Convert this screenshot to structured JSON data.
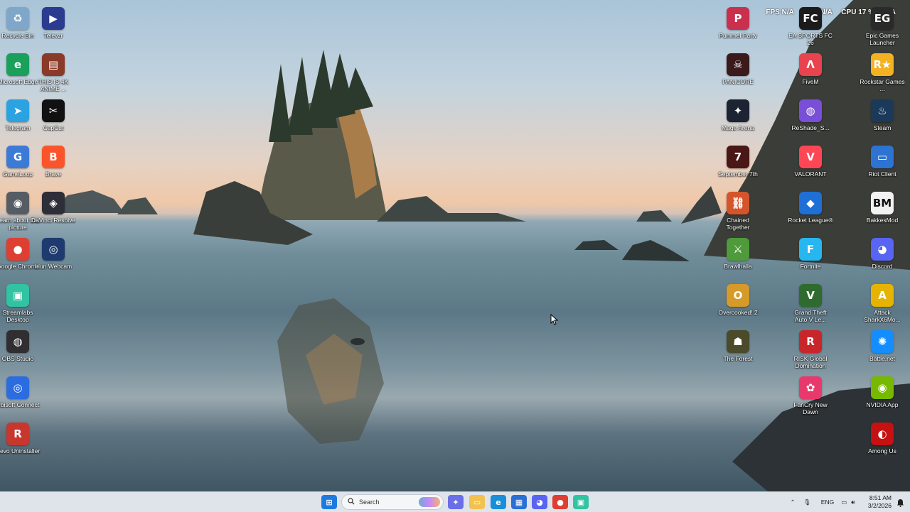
{
  "desktop": {
    "icons": [
      {
        "label": "Recycle Bin",
        "icon": "recycle-bin-icon",
        "glyph": "♻",
        "color": "#7fa7c9"
      },
      {
        "label": "Microsoft Edge",
        "icon": "edge-icon",
        "glyph": "e",
        "color": "#1aa05b"
      },
      {
        "label": "Telegram",
        "icon": "telegram-icon",
        "glyph": "➤",
        "color": "#2aa3e0"
      },
      {
        "label": "GameLoop",
        "icon": "gameloop-icon",
        "glyph": "G",
        "color": "#3b7bd6"
      },
      {
        "label": "Learn about this picture",
        "icon": "camera-icon",
        "glyph": "◉",
        "color": "#555c64"
      },
      {
        "label": "Google Chrome",
        "icon": "chrome-icon",
        "glyph": "●",
        "color": "#de3f33"
      },
      {
        "label": "Streamlabs Desktop",
        "icon": "streamlabs-icon",
        "glyph": "▣",
        "color": "#31c3a2"
      },
      {
        "label": "OBS Studio",
        "icon": "obs-icon",
        "glyph": "◍",
        "color": "#302e31"
      },
      {
        "label": "Ubisoft Connect",
        "icon": "ubisoft-icon",
        "glyph": "◎",
        "color": "#2b6de0"
      },
      {
        "label": "Revo Uninstaller",
        "icon": "revo-uninstaller-icon",
        "glyph": "R",
        "color": "#c8372d"
      },
      {
        "label": "Televzr",
        "icon": "televzr-icon",
        "glyph": "▶",
        "color": "#2b3b8f"
      },
      {
        "label": "THIS IS 4K ANIME ...",
        "icon": "video-file-icon",
        "glyph": "▤",
        "color": "#8a3a28"
      },
      {
        "label": "CapCut",
        "icon": "capcut-icon",
        "glyph": "✂",
        "color": "#111111"
      },
      {
        "label": "Brave",
        "icon": "brave-icon",
        "glyph": "B",
        "color": "#fb542b"
      },
      {
        "label": "DaVinci Resolve",
        "icon": "davinci-resolve-icon",
        "glyph": "◈",
        "color": "#2c2f38"
      },
      {
        "label": "Iriun Webcam",
        "icon": "webcam-icon",
        "glyph": "◎",
        "color": "#1e3a6e"
      },
      {
        "label": "Pummel Party",
        "icon": "pummel-party-icon",
        "glyph": "P",
        "color": "#c9304d"
      },
      {
        "label": "PANICORE",
        "icon": "panicore-icon",
        "glyph": "☠",
        "color": "#3a1a1a"
      },
      {
        "label": "Mage Arena",
        "icon": "mage-arena-icon",
        "glyph": "✦",
        "color": "#1c2333"
      },
      {
        "label": "September 7th",
        "icon": "september-7th-icon",
        "glyph": "7",
        "color": "#4a1616"
      },
      {
        "label": "Chained Together",
        "icon": "chained-together-icon",
        "glyph": "⛓",
        "color": "#d4552b"
      },
      {
        "label": "Brawlhalla",
        "icon": "brawlhalla-icon",
        "glyph": "⚔",
        "color": "#4f9a3a"
      },
      {
        "label": "Overcooked! 2",
        "icon": "overcooked-icon",
        "glyph": "O",
        "color": "#d59a2a"
      },
      {
        "label": "The Forest",
        "icon": "the-forest-icon",
        "glyph": "☗",
        "color": "#4b4a2a"
      },
      {
        "label": "EA SPORTS FC 26",
        "icon": "ea-sports-fc-icon",
        "glyph": "FC",
        "color": "#1b1b1b"
      },
      {
        "label": "FiveM",
        "icon": "fivem-icon",
        "glyph": "Λ",
        "color": "#e8434e"
      },
      {
        "label": "ReShade_S...",
        "icon": "reshade-icon",
        "glyph": "◍",
        "color": "#7a4fd8"
      },
      {
        "label": "VALORANT",
        "icon": "valorant-icon",
        "glyph": "V",
        "color": "#ff4655"
      },
      {
        "label": "Rocket League®",
        "icon": "rocket-league-icon",
        "glyph": "◆",
        "color": "#1e6fd6"
      },
      {
        "label": "Fortnite",
        "icon": "fortnite-icon",
        "glyph": "F",
        "color": "#26b6f0"
      },
      {
        "label": "Grand Theft Auto V Le...",
        "icon": "gta-v-icon",
        "glyph": "V",
        "color": "#2f6b2f"
      },
      {
        "label": "RISK Global Domination",
        "icon": "risk-icon",
        "glyph": "R",
        "color": "#c9262c"
      },
      {
        "label": "FanCry New Dawn",
        "icon": "far-cry-icon",
        "glyph": "✿",
        "color": "#e8396d"
      },
      {
        "label": "Epic Games Launcher",
        "icon": "epic-games-icon",
        "glyph": "EG",
        "color": "#2a2a2a"
      },
      {
        "label": "Rockstar Games ...",
        "icon": "rockstar-games-icon",
        "glyph": "R★",
        "color": "#f4b223"
      },
      {
        "label": "Steam",
        "icon": "steam-icon",
        "glyph": "♨",
        "color": "#1b3a5a"
      },
      {
        "label": "Riot Client",
        "icon": "riot-client-icon",
        "glyph": "▭",
        "color": "#2d73d2"
      },
      {
        "label": "BakkesMod",
        "icon": "bakkesmod-icon",
        "glyph": "BM",
        "color": "#f2f2f2"
      },
      {
        "label": "Discord",
        "icon": "discord-icon",
        "glyph": "◕",
        "color": "#5865f2"
      },
      {
        "label": "Attack SharkX6Mo...",
        "icon": "attack-shark-icon",
        "glyph": "A",
        "color": "#e6b400"
      },
      {
        "label": "Battle.net",
        "icon": "battlenet-icon",
        "glyph": "✺",
        "color": "#148eff"
      },
      {
        "label": "NVIDIA App",
        "icon": "nvidia-icon",
        "glyph": "◉",
        "color": "#76b900"
      },
      {
        "label": "Among Us",
        "icon": "among-us-icon",
        "glyph": "◐",
        "color": "#c51111"
      }
    ]
  },
  "overlay": {
    "fps": "FPS N/A",
    "gpu": "GPU N/A",
    "cpu": "CPU 17 %",
    "ram": "N/A"
  },
  "taskbar": {
    "search_placeholder": "Search",
    "apps": [
      {
        "icon": "windows-start-icon",
        "glyph": "⊞",
        "color": "#1f7ae0"
      },
      {
        "icon": "copilot-icon",
        "glyph": "✦",
        "color": "#6a6fe8"
      },
      {
        "icon": "file-explorer-icon",
        "glyph": "▭",
        "color": "#f2c14e"
      },
      {
        "icon": "edge-icon",
        "glyph": "e",
        "color": "#1a8fd8"
      },
      {
        "icon": "microsoft-store-icon",
        "glyph": "▦",
        "color": "#2a6fd6"
      },
      {
        "icon": "discord-icon",
        "glyph": "◕",
        "color": "#5865f2"
      },
      {
        "icon": "chrome-icon",
        "glyph": "●",
        "color": "#de3f33"
      },
      {
        "icon": "streamlabs-icon",
        "glyph": "▣",
        "color": "#31c3a2"
      }
    ],
    "tray": {
      "language": "ENG",
      "time": "8:51 AM",
      "date": "3/2/2026"
    }
  }
}
